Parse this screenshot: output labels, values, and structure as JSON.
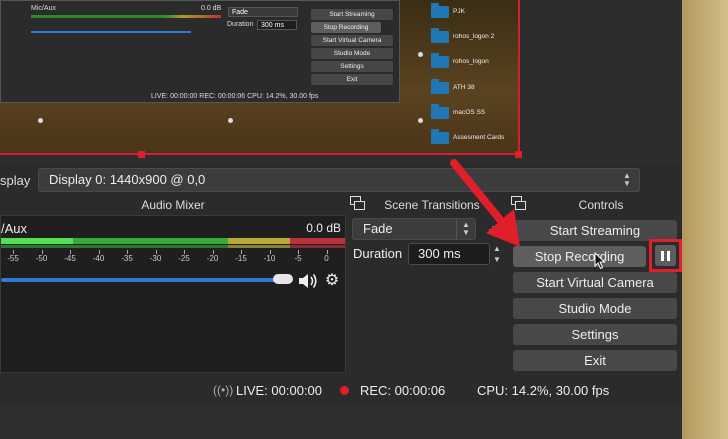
{
  "preview": {
    "nested": {
      "track_name": "Mic/Aux",
      "track_db": "0.0 dB",
      "transition": "Fade",
      "duration_label": "Duration",
      "duration_value": "300 ms",
      "buttons": [
        "Start Streaming",
        "Stop Recording",
        "Start Virtual Camera",
        "Studio Mode",
        "Settings",
        "Exit"
      ],
      "status": "LIVE: 00:00:00    REC: 00:00:06    CPU: 14.2%, 30.00 fps"
    },
    "folders": [
      "PJK",
      "rohos_logon 2",
      "rohos_logon",
      "ATH 38",
      "macOS SS",
      "Assesment Cards"
    ]
  },
  "display": {
    "label": "splay",
    "value": "Display 0: 1440x900 @ 0,0"
  },
  "docks": {
    "audio_mixer_title": "Audio Mixer",
    "scene_transitions_title": "Scene Transitions",
    "controls_title": "Controls"
  },
  "mixer": {
    "track_name": "/Aux",
    "track_db": "0.0 dB",
    "scale_labels": [
      "-55",
      "-50",
      "-45",
      "-40",
      "-35",
      "-30",
      "-25",
      "-20",
      "-15",
      "-10",
      "-5",
      "0"
    ],
    "volume_fraction": 1.0
  },
  "transitions": {
    "selected": "Fade",
    "duration_label": "Duration",
    "duration_value": "300 ms"
  },
  "controls": {
    "start_streaming": "Start Streaming",
    "stop_recording": "Stop Recording",
    "start_virtual_camera": "Start Virtual Camera",
    "studio_mode": "Studio Mode",
    "settings": "Settings",
    "exit": "Exit"
  },
  "status": {
    "live": "LIVE: 00:00:00",
    "rec": "REC: 00:00:06",
    "cpu": "CPU: 14.2%, 30.00 fps"
  },
  "colors": {
    "accent_red": "#e01f2a",
    "fader_blue": "#2f7ad6"
  }
}
